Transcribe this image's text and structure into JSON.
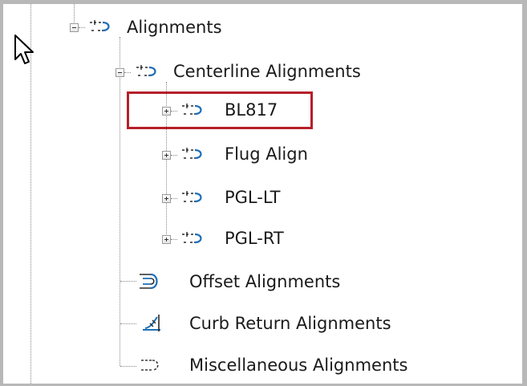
{
  "tree": {
    "root": {
      "label": "Alignments",
      "icon": "alignment-icon",
      "expanded": true
    },
    "centerline": {
      "label": "Centerline Alignments",
      "icon": "alignment-icon",
      "expanded": true
    },
    "alignments": [
      {
        "label": "BL817",
        "icon": "alignment-icon",
        "expanded": false,
        "highlighted": true
      },
      {
        "label": "Flug Align",
        "icon": "alignment-icon",
        "expanded": false
      },
      {
        "label": "PGL-LT",
        "icon": "alignment-icon",
        "expanded": false
      },
      {
        "label": "PGL-RT",
        "icon": "alignment-icon",
        "expanded": false
      }
    ],
    "offset": {
      "label": "Offset Alignments",
      "icon": "offset-alignment-icon"
    },
    "curb_return": {
      "label": "Curb Return Alignments",
      "icon": "curb-return-alignment-icon"
    },
    "miscellaneous": {
      "label": "Miscellaneous Alignments",
      "icon": "miscellaneous-alignment-icon"
    }
  },
  "colors": {
    "highlight": "#b5202a",
    "frame": "#b8b8b8",
    "icon_blue": "#1e6fb8",
    "icon_dark": "#2a2a2a"
  }
}
